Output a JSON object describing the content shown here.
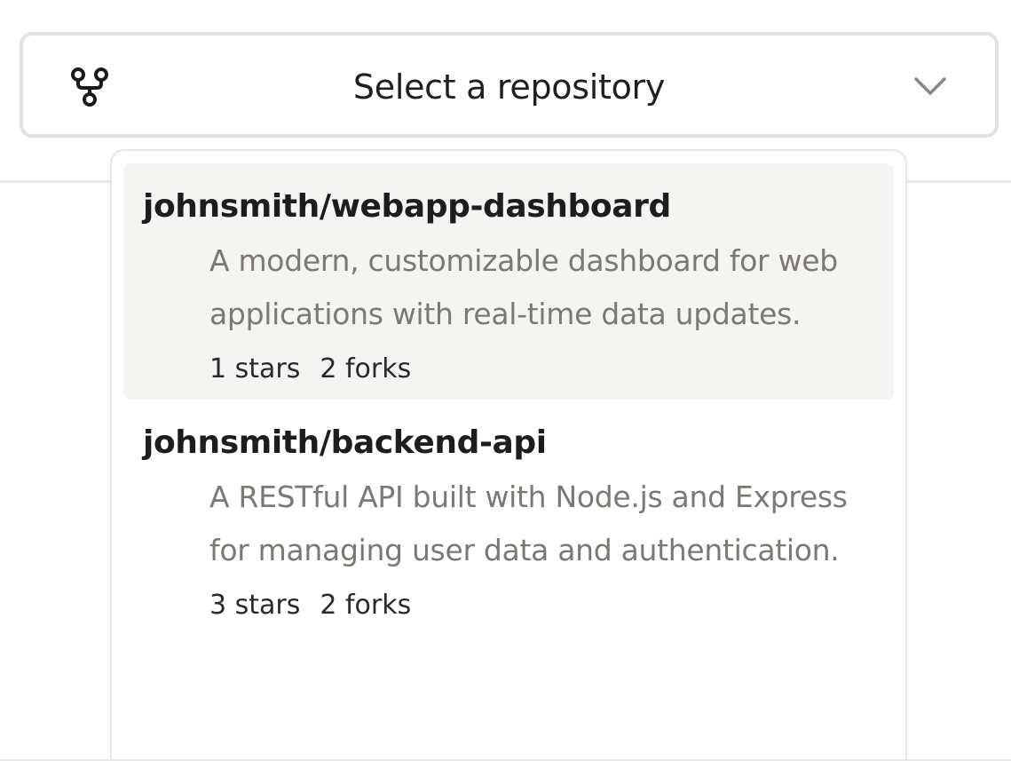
{
  "select": {
    "placeholder": "Select a repository",
    "leading_icon": "repo-fork-icon",
    "trailing_icon": "chevron-down-icon"
  },
  "repositories": [
    {
      "name": "johnsmith/webapp-dashboard",
      "description": "A modern, customizable dashboard for web applications with real-time data updates.",
      "stars": "1 stars",
      "forks": "2 forks",
      "highlighted": true
    },
    {
      "name": "johnsmith/backend-api",
      "description": "A RESTful API built with Node.js and Express for managing user data and authentication.",
      "stars": "3 stars",
      "forks": "2 forks",
      "highlighted": false
    }
  ],
  "colors": {
    "highlight_bg": "#f4f4f2",
    "border": "#e3e2e0",
    "description_text": "#7c7874",
    "primary_text": "#1d1d1d"
  }
}
